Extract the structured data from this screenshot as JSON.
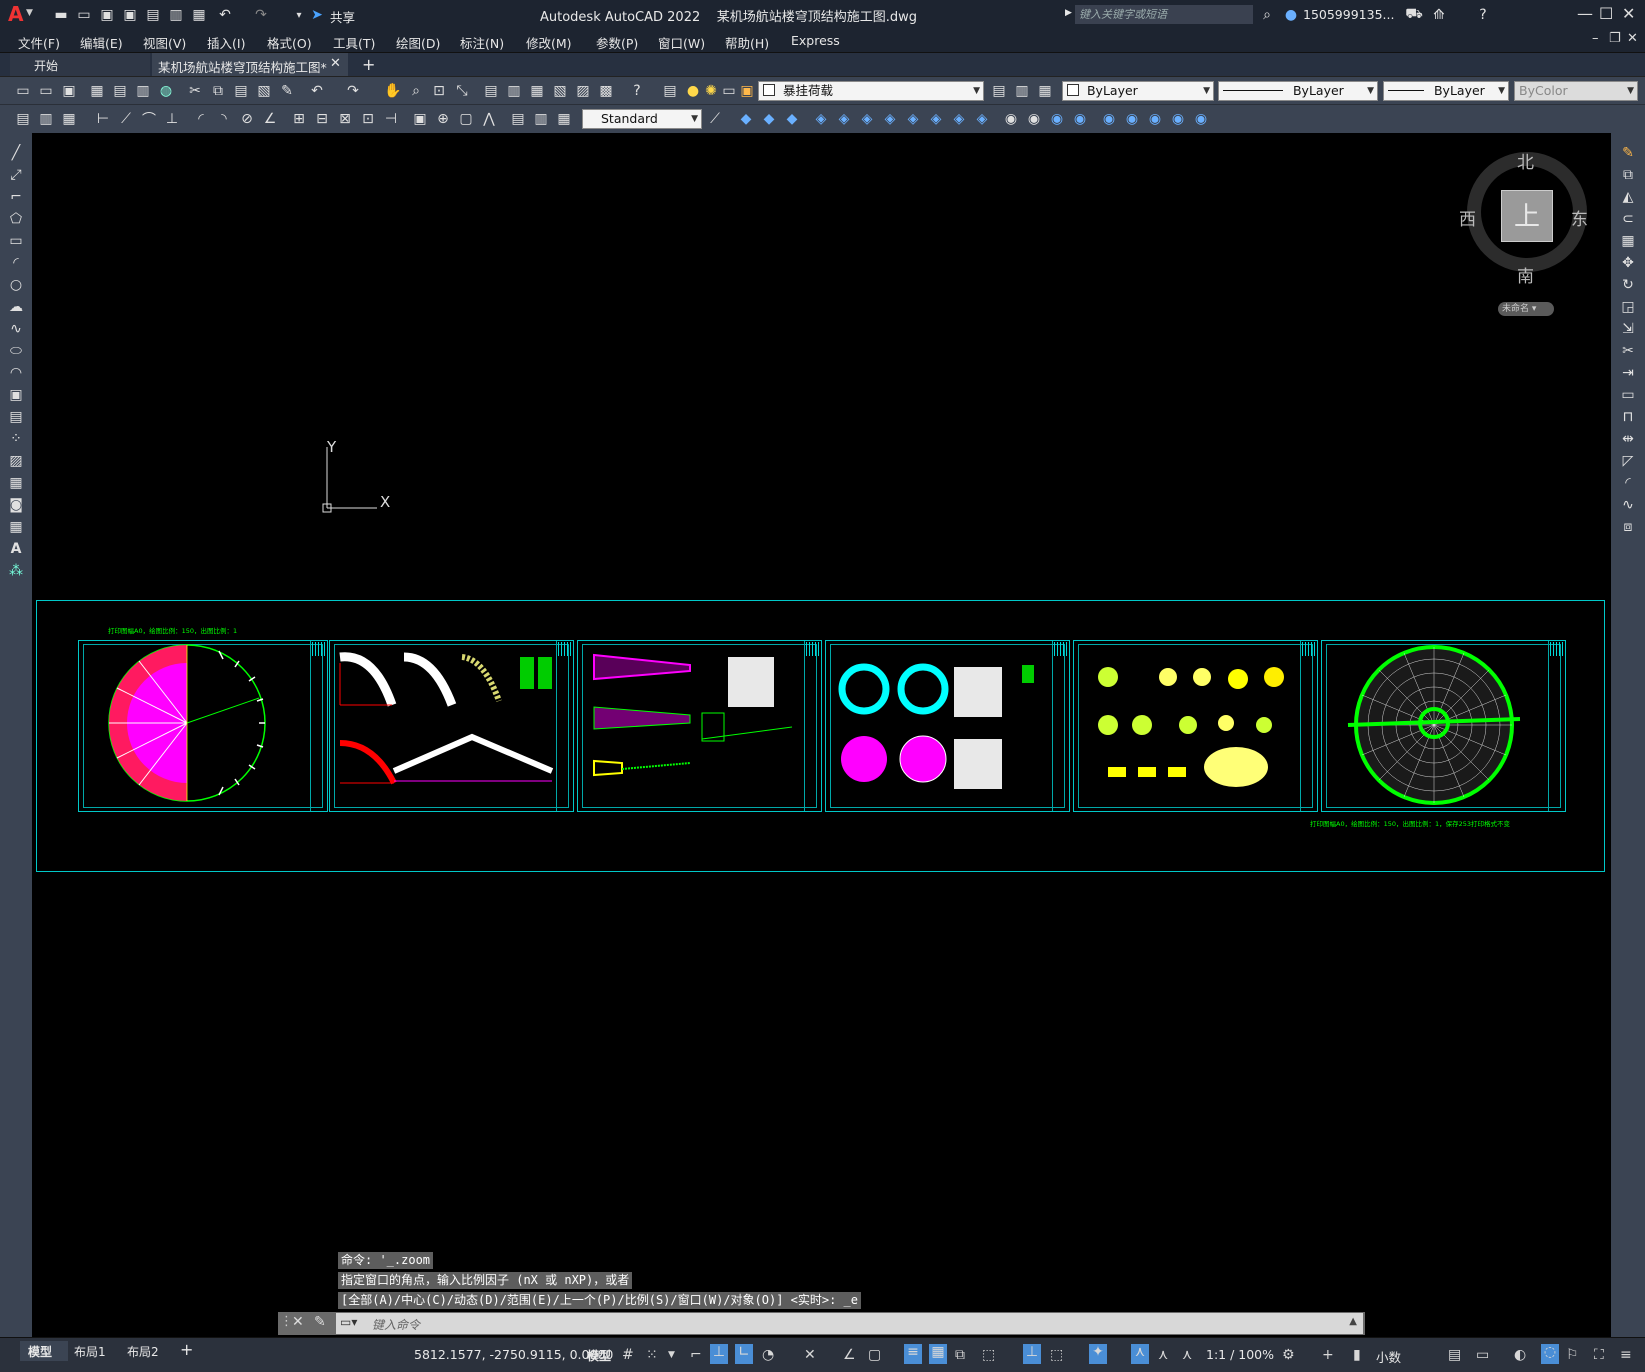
{
  "app": {
    "title": "Autodesk AutoCAD 2022",
    "file_title": "某机场航站楼穹顶结构施工图.dwg",
    "share_label": "共享",
    "search_placeholder": "键入关键字或短语",
    "user": "1505999135...",
    "logo_letter": "A"
  },
  "menu": [
    "文件(F)",
    "编辑(E)",
    "视图(V)",
    "插入(I)",
    "格式(O)",
    "工具(T)",
    "绘图(D)",
    "标注(N)",
    "修改(M)",
    "参数(P)",
    "窗口(W)",
    "帮助(H)",
    "Express"
  ],
  "tabs": {
    "start": "开始",
    "active": "某机场航站楼穹顶结构施工图*",
    "add": "+"
  },
  "toolbar": {
    "layer": "暴挂荷载",
    "color": "ByLayer",
    "linetype": "ByLayer",
    "lineweight": "ByLayer",
    "plotstyle": "ByColor",
    "textstyle": "Standard"
  },
  "viewcube": {
    "north": "北",
    "south": "南",
    "east": "东",
    "west": "西",
    "face": "上",
    "wcs": "未命名"
  },
  "ucs": {
    "x": "X",
    "y": "Y"
  },
  "drawing": {
    "note_top": "打印图幅A0，绘图比例：150，出图比例：1",
    "note_bottom": "打印图幅A0，绘图比例：150，出图比例：1，保存253打印格式不变",
    "sheet_count": 6
  },
  "command": {
    "line1": "命令: '_.zoom",
    "line2": "指定窗口的角点，输入比例因子 (nX 或 nXP)，或者",
    "line3": "[全部(A)/中心(C)/动态(D)/范围(E)/上一个(P)/比例(S)/窗口(W)/对象(O)] <实时>: _e",
    "placeholder": "键入命令"
  },
  "layout_tabs": [
    "模型",
    "布局1",
    "布局2"
  ],
  "status": {
    "coords": "5812.1577, -2750.9115, 0.0000",
    "mode": "模型",
    "scale": "1:1 / 100%",
    "units": "小数"
  },
  "colors": {
    "ui_dark": "#1d2430",
    "toolbar": "#3b4453",
    "frame": "#00c8c8",
    "green": "#00ff00",
    "magenta": "#ff00ff",
    "cyan": "#00ffff",
    "yellow": "#ffff66",
    "red": "#ff0000"
  }
}
